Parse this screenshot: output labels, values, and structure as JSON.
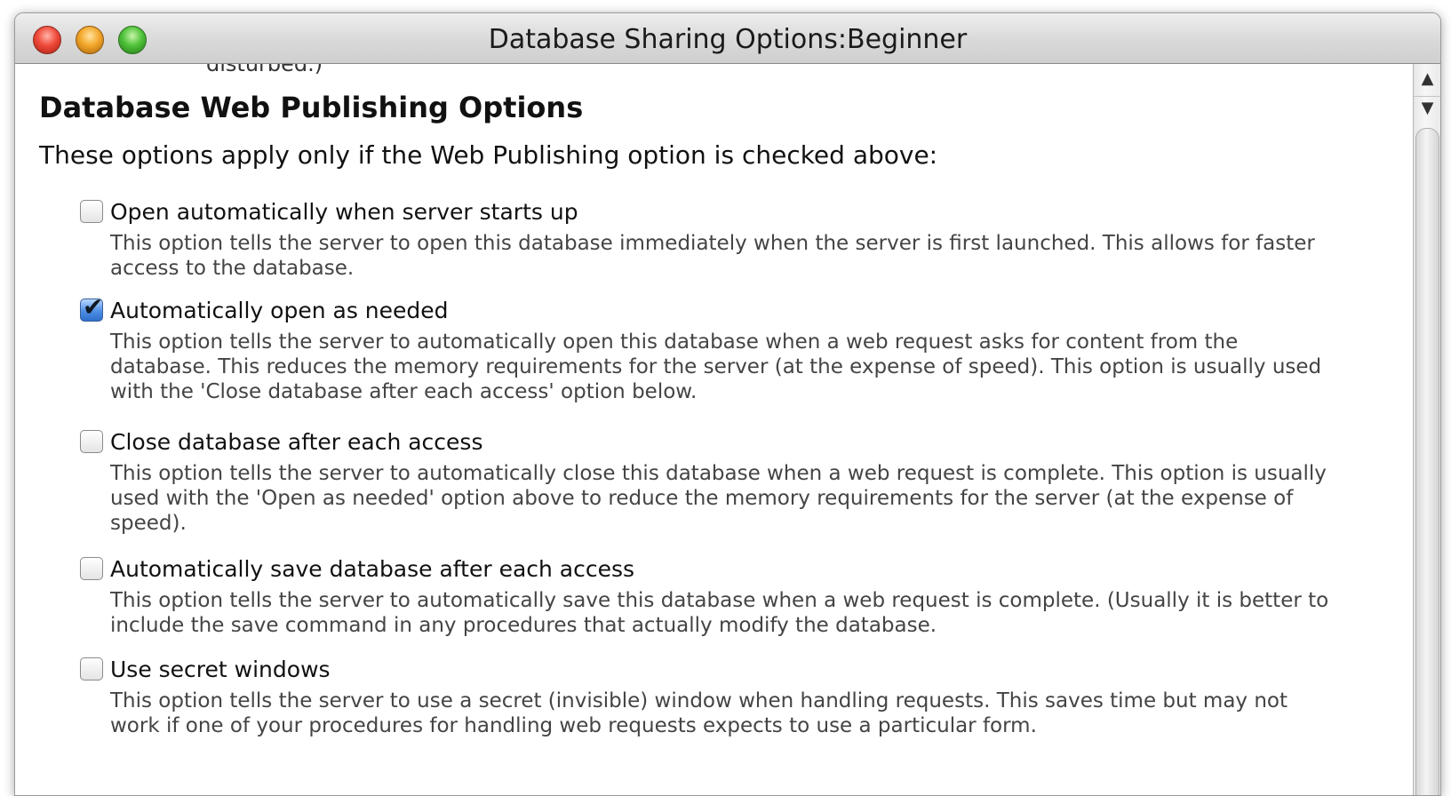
{
  "window": {
    "title": "Database Sharing Options:Beginner"
  },
  "content": {
    "cutoff_text": "disturbed.)",
    "heading": "Database Web Publishing Options",
    "intro": "These options apply only if the Web Publishing option is checked above:",
    "options": [
      {
        "label": "Open automatically when server starts up",
        "checked": false,
        "description": "This option tells the server to open this database immediately when the server is first launched. This allows for faster access to the database."
      },
      {
        "label": "Automatically open as needed",
        "checked": true,
        "description": "This option tells the server to automatically open this database when a web request asks for content from the database. This reduces the memory requirements for the server (at the expense of speed). This option is usually used with the 'Close database after each access' option below."
      },
      {
        "label": "Close database after each access",
        "checked": false,
        "description": "This option tells the server to automatically close this database when a web request is complete. This option is usually used with the 'Open as needed' option above to reduce the memory requirements for the server (at the expense of speed)."
      },
      {
        "label": "Automatically save database after each access",
        "checked": false,
        "description": "This option tells the server to automatically save this database when a web request is complete. (Usually it is better to include the save command in any procedures that actually modify the database."
      },
      {
        "label": "Use secret windows",
        "checked": false,
        "description": "This option tells the server to use a secret (invisible) window when handling requests. This saves time but may not work if one of your procedures for handling web requests expects to use a particular form."
      }
    ]
  },
  "scrollbar": {
    "up_arrow": "▲",
    "down_arrow": "▼"
  },
  "icons": {
    "checkmark": "✔"
  }
}
